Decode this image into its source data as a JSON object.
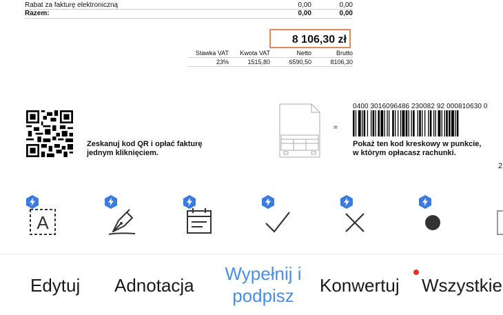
{
  "summary": [
    {
      "label": "Rabat za fakturę elektroniczną",
      "v1": "0,00",
      "v2": "0,00",
      "bold": false
    },
    {
      "label": "Razem:",
      "v1": "0,00",
      "v2": "0,00",
      "bold": true
    }
  ],
  "total": "8 106,30 zł",
  "vat_table": {
    "headers": [
      "Stawka VAT",
      "Kwota VAT",
      "Netto",
      "Brutto"
    ],
    "rows": [
      [
        "23%",
        "1515,80",
        "6590,50",
        "8106,30"
      ]
    ]
  },
  "qr_caption_line1": "Zeskanuj kod QR i opłać fakturę",
  "qr_caption_line2": "jednym kliknięciem.",
  "equals_sign": "=",
  "barcode_number": "0400 3016096486 230082 92 000810630 0",
  "barcode_caption_line1": "Pokaż ten kod kreskowy w punkcie,",
  "barcode_caption_line2": "w którym opłacasz rachunki.",
  "page_number": "2",
  "tools": [
    {
      "icon": "text-box-icon"
    },
    {
      "icon": "signature-pen-icon"
    },
    {
      "icon": "calendar-icon"
    },
    {
      "icon": "checkmark-icon"
    },
    {
      "icon": "cross-icon"
    },
    {
      "icon": "dot-icon"
    },
    {
      "icon": "square-icon"
    }
  ],
  "colors": {
    "accent": "#4a8fe0",
    "badge": "#3a7be0",
    "highlight_border": "#e08a5a",
    "notification": "#e3352b"
  },
  "tabs": [
    {
      "label": "Edytuj"
    },
    {
      "label": "Adnotacja"
    },
    {
      "label_line1": "Wypełnij i",
      "label_line2": "podpisz",
      "active": true
    },
    {
      "label": "Konwertuj"
    },
    {
      "label": "Wszystkie"
    }
  ]
}
